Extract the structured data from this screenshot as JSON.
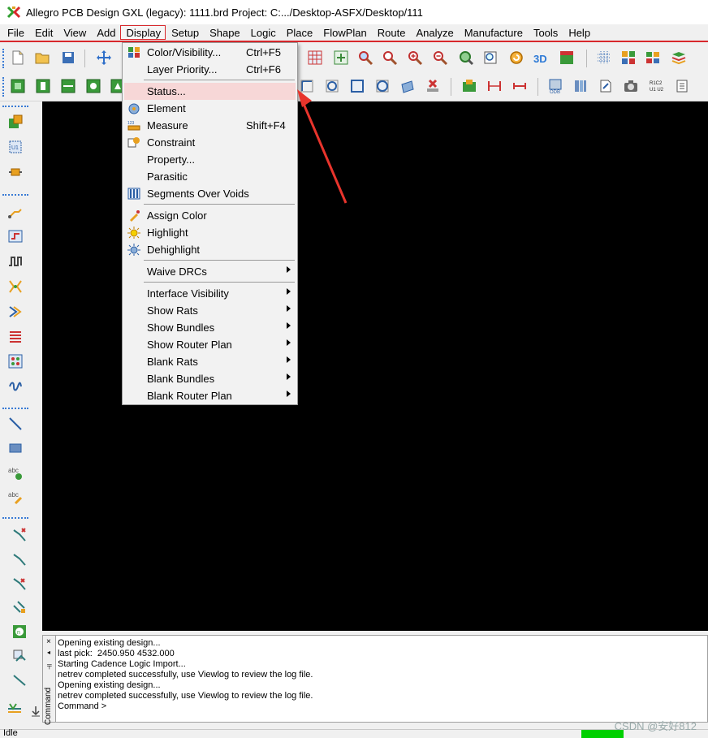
{
  "titlebar": {
    "title": "Allegro PCB Design GXL (legacy): 1111.brd  Project: C:.../Desktop-ASFX/Desktop/111",
    "icon": "allegro-app-icon"
  },
  "menubar": {
    "items": [
      "File",
      "Edit",
      "View",
      "Add",
      "Display",
      "Setup",
      "Shape",
      "Logic",
      "Place",
      "FlowPlan",
      "Route",
      "Analyze",
      "Manufacture",
      "Tools",
      "Help"
    ],
    "active": "Display"
  },
  "display_menu": {
    "items": [
      {
        "label": "Color/Visibility...",
        "shortcut": "Ctrl+F5",
        "icon": "color-visibility-icon",
        "submenu": false
      },
      {
        "label": "Layer Priority...",
        "shortcut": "Ctrl+F6",
        "icon": "",
        "submenu": false
      },
      {
        "label": "Status...",
        "shortcut": "",
        "icon": "",
        "submenu": false,
        "highlighted": true
      },
      {
        "label": "Element",
        "shortcut": "",
        "icon": "element-info-icon",
        "submenu": false
      },
      {
        "label": "Measure",
        "shortcut": "Shift+F4",
        "icon": "measure-ruler-icon",
        "submenu": false
      },
      {
        "label": "Constraint",
        "shortcut": "",
        "icon": "constraint-icon",
        "submenu": false
      },
      {
        "label": "Property...",
        "shortcut": "",
        "icon": "",
        "submenu": false
      },
      {
        "label": "Parasitic",
        "shortcut": "",
        "icon": "",
        "submenu": false
      },
      {
        "label": "Segments Over Voids",
        "shortcut": "",
        "icon": "segments-over-voids-icon",
        "submenu": false
      },
      {
        "label": "Assign Color",
        "shortcut": "",
        "icon": "assign-color-icon",
        "submenu": false
      },
      {
        "label": "Highlight",
        "shortcut": "",
        "icon": "highlight-icon",
        "submenu": false
      },
      {
        "label": "Dehighlight",
        "shortcut": "",
        "icon": "dehighlight-icon",
        "submenu": false
      },
      {
        "label": "Waive DRCs",
        "shortcut": "",
        "icon": "",
        "submenu": true
      },
      {
        "label": "Interface Visibility",
        "shortcut": "",
        "icon": "",
        "submenu": true
      },
      {
        "label": "Show Rats",
        "shortcut": "",
        "icon": "",
        "submenu": true
      },
      {
        "label": "Show Bundles",
        "shortcut": "",
        "icon": "",
        "submenu": true
      },
      {
        "label": "Show Router Plan",
        "shortcut": "",
        "icon": "",
        "submenu": true
      },
      {
        "label": "Blank Rats",
        "shortcut": "",
        "icon": "",
        "submenu": true
      },
      {
        "label": "Blank Bundles",
        "shortcut": "",
        "icon": "",
        "submenu": true
      },
      {
        "label": "Blank Router Plan",
        "shortcut": "",
        "icon": "",
        "submenu": true
      }
    ]
  },
  "command_panel": {
    "close": "×",
    "side_label": "Command",
    "lines": [
      "Opening existing design...",
      "last pick:  2450.950 4532.000",
      "Starting Cadence Logic Import...",
      "netrev completed successfully, use Viewlog to review the log file.",
      "Opening existing design...",
      "netrev completed successfully, use Viewlog to review the log file.",
      "Command >"
    ]
  },
  "statusbar": {
    "state": "Idle",
    "indicator_color": "#00d000"
  },
  "watermark": "CSDN @安好812",
  "colors": {
    "accent_red": "#d8282c",
    "canvas": "#000000",
    "menu_highlight": "#f7d7d7"
  }
}
